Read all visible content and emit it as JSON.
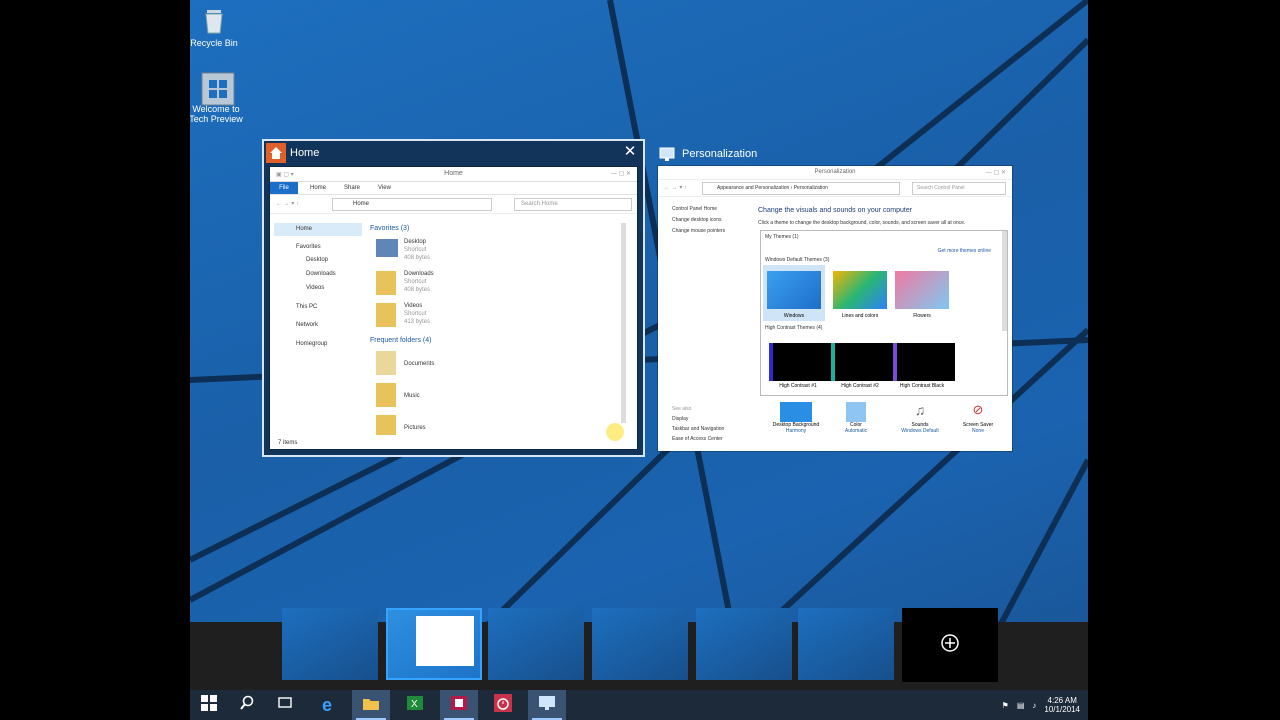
{
  "desktop": {
    "icons": [
      {
        "label": "Recycle Bin",
        "icon": "recycle-bin-icon"
      },
      {
        "label": "Welcome to Tech Preview",
        "icon": "windows-welcome-icon"
      }
    ]
  },
  "task_view": {
    "home_window": {
      "title": "Home",
      "inner_title": "Home",
      "ribbon_tabs": [
        "File",
        "Home",
        "Share",
        "View"
      ],
      "address": "Home",
      "search_placeholder": "Search Home",
      "nav": {
        "home": "Home",
        "favorites": "Favorites",
        "desktop": "Desktop",
        "downloads": "Downloads",
        "videos": "Videos",
        "this_pc": "This PC",
        "network": "Network",
        "homegroup": "Homegroup"
      },
      "favorites_header": "Favorites (3)",
      "favorites": [
        {
          "name": "Desktop",
          "sub": "Shortcut",
          "size": "408 bytes"
        },
        {
          "name": "Downloads",
          "sub": "Shortcut",
          "size": "408 bytes"
        },
        {
          "name": "Videos",
          "sub": "Shortcut",
          "size": "413 bytes"
        }
      ],
      "frequent_header": "Frequent folders (4)",
      "frequent": [
        {
          "name": "Documents"
        },
        {
          "name": "Music"
        },
        {
          "name": "Pictures"
        }
      ],
      "status": "7 items"
    },
    "personalization_window": {
      "title": "Personalization",
      "inner_title": "Personalization",
      "breadcrumb": "Appearance and Personalization  ›  Personalization",
      "search_placeholder": "Search Control Panel",
      "left_links": [
        "Control Panel Home",
        "Change desktop icons",
        "Change mouse pointers"
      ],
      "heading": "Change the visuals and sounds on your computer",
      "subheading": "Click a theme to change the desktop background, color, sounds, and screen saver all at once.",
      "my_themes": "My Themes (1)",
      "get_more": "Get more themes online",
      "default_themes": "Windows Default Themes (3)",
      "themes": [
        "Windows",
        "Lines and colors",
        "Flowers"
      ],
      "high_contrast": "High Contrast Themes (4)",
      "hc_themes": [
        "High Contrast #1",
        "High Contrast #2",
        "High Contrast Black"
      ],
      "see_also": [
        "See also",
        "Display",
        "Taskbar and Navigation",
        "Ease of Access Center"
      ],
      "bottom": [
        {
          "label": "Desktop Background",
          "value": "Harmony"
        },
        {
          "label": "Color",
          "value": "Automatic"
        },
        {
          "label": "Sounds",
          "value": "Windows Default"
        },
        {
          "label": "Screen Saver",
          "value": "None"
        }
      ]
    }
  },
  "virtual_desktops": {
    "count": 6,
    "active_index": 1,
    "add_icon": "plus-icon"
  },
  "taskbar": {
    "buttons": [
      "start-icon",
      "search-icon",
      "task-view-icon",
      "internet-explorer-icon",
      "file-explorer-icon",
      "excel-icon",
      "publisher-icon",
      "alarms-icon",
      "personalization-icon"
    ],
    "time": "4:26 AM",
    "date": "10/1/2014"
  },
  "colors": {
    "accent": "#1d6fbf",
    "selection": "#36a3ff"
  }
}
